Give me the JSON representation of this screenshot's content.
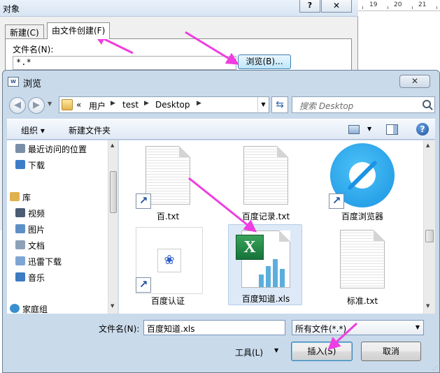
{
  "object_dialog": {
    "title": "对象",
    "help": "?",
    "close": "✕",
    "tabs": [
      {
        "label": "新建(C)"
      },
      {
        "label": "由文件创建(F)"
      }
    ],
    "file_name_label": "文件名(N):",
    "file_name_value": "*.*",
    "browse_button": "浏览(B)..."
  },
  "ruler": {
    "ticks": [
      "19",
      "20",
      "21"
    ]
  },
  "browse_dialog": {
    "title": "浏览",
    "app_icon": "W",
    "close": "✕",
    "address": {
      "chevrons": "«",
      "segments": [
        "用户",
        "test",
        "Desktop"
      ]
    },
    "search_placeholder": "搜索 Desktop",
    "command_bar": {
      "organize": "组织 ▾",
      "new_folder": "新建文件夹"
    },
    "nav_items": [
      {
        "label": "最近访问的位置",
        "icon": "recent-places-icon",
        "color": "#7a8ea8"
      },
      {
        "label": "下载",
        "icon": "downloads-folder-icon",
        "color": "#3d7dc8"
      },
      {
        "label": "库",
        "icon": "library-icon",
        "color": "#e0b14e"
      },
      {
        "label": "视频",
        "icon": "video-library-icon",
        "color": "#4b5d73"
      },
      {
        "label": "图片",
        "icon": "pictures-library-icon",
        "color": "#5e8fc7"
      },
      {
        "label": "文档",
        "icon": "documents-library-icon",
        "color": "#8da1b8"
      },
      {
        "label": "迅雷下载",
        "icon": "thunder-download-icon",
        "color": "#7fa5d3"
      },
      {
        "label": "音乐",
        "icon": "music-library-icon",
        "color": "#3e7bc2"
      },
      {
        "label": "家庭组",
        "icon": "homegroup-icon",
        "color": "#3a8fd0"
      }
    ],
    "files": [
      {
        "name": "百.txt",
        "icon": "text-file-shortcut-icon"
      },
      {
        "name": "百度记录.txt",
        "icon": "text-file-icon"
      },
      {
        "name": "百度浏览器",
        "icon": "baidu-browser-shortcut-icon"
      },
      {
        "name": "百度认证",
        "icon": "baidu-auth-shortcut-icon"
      },
      {
        "name": "百度知道.xls",
        "icon": "excel-file-icon",
        "selected": true
      },
      {
        "name": "标准.txt",
        "icon": "text-file-icon"
      }
    ],
    "file_name_label": "文件名(N):",
    "file_name_value": "百度知道.xls",
    "file_type_value": "所有文件(*.*)",
    "tools_label": "工具(L)",
    "insert_button": "插入(S)",
    "cancel_button": "取消"
  },
  "colors": {
    "annotation_arrow": "#ee3de0",
    "dialog_frame": "#c9daeb"
  }
}
